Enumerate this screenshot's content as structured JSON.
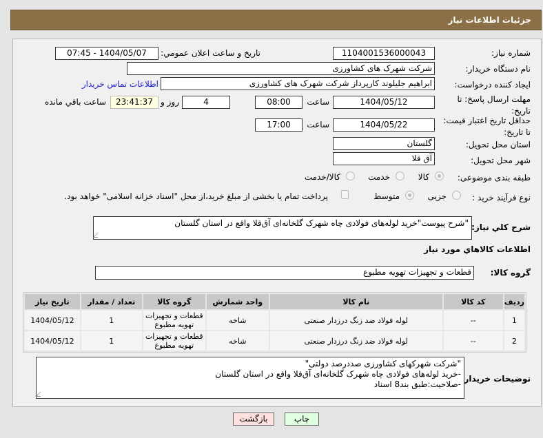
{
  "header": {
    "title": "جزئیات اطلاعات نیاز"
  },
  "form": {
    "need_number_label": "شماره نیاز:",
    "need_number": "1104001536000043",
    "announce_label": "تاریخ و ساعت اعلان عمومي:",
    "announce_value": "1404/05/07 - 07:45",
    "buyer_label": "نام دستگاه خريدار:",
    "buyer": "شرکت شهرک های کشاورزی",
    "creator_label": "ايجاد کننده درخواست:",
    "creator": "ابراهیم جلیلوند کارپرداز شرکت شهرک های کشاورزی",
    "contact_link": "اطلاعات تماس خریدار",
    "deadline_label": "مهلت ارسال پاسخ: تا تاریخ:",
    "deadline_date": "1404/05/12",
    "time_label": "ساعت",
    "deadline_time": "08:00",
    "days": "4",
    "days_label": "روز و",
    "remaining": "23:41:37",
    "remaining_label": "ساعت باقي مانده",
    "validity_label": "حداقل تاریخ اعتبار قیمت: تا تاریخ:",
    "validity_date": "1404/05/22",
    "validity_time": "17:00",
    "province_label": "استان محل تحویل:",
    "province": "گلستان",
    "city_label": "شهر محل تحویل:",
    "city": "آق قلا",
    "category_label": "طبقه بندی موضوعی:",
    "category_options": [
      "کالا",
      "خدمت",
      "کالا/خدمت"
    ],
    "process_label": "نوع فرآیند خرید :",
    "process_options": [
      "جزیی",
      "متوسط"
    ],
    "payment_note": "پرداخت تمام یا بخشی از مبلغ خرید،از محل \"اسناد خزانه اسلامی\" خواهد بود.",
    "description_label": "شرح کلي نياز:",
    "description": "\"شرح پیوست\"خرید لوله‌های فولادی چاه شهرک گلخانه‌ای آق‌قلا واقع در استان گلستان",
    "goods_section": "اطلاعات کالاهاي مورد نياز",
    "goods_group_label": "گروه کالا:",
    "goods_group": "قطعات و تجهیزات تهویه مطبوع"
  },
  "table": {
    "headers": [
      "رديف",
      "کد کالا",
      "نام کالا",
      "واحد شمارش",
      "گروه کالا",
      "تعداد / مقدار",
      "تاريخ نياز"
    ],
    "rows": [
      [
        "1",
        "--",
        "لوله فولاد ضد زنگ درزدار صنعتی",
        "شاخه",
        "قطعات و تجهیزات تهویه مطبوع",
        "1",
        "1404/05/12"
      ],
      [
        "2",
        "--",
        "لوله فولاد ضد زنگ درزدار صنعتی",
        "شاخه",
        "قطعات و تجهیزات تهویه مطبوع",
        "1",
        "1404/05/12"
      ]
    ]
  },
  "buyer_notes": {
    "label": "توضیحات خریدار:",
    "text": "\"شرکت شهرکهای کشاورزی صددرصد دولتی\"\n-خرید لوله‌های فولادی چاه شهرک گلخانه‌ای آق‌قلا واقع در استان گلستان\n-صلاحیت:طبق بند8 اسناد"
  },
  "buttons": {
    "back": "بازگشت",
    "print": "چاپ"
  }
}
